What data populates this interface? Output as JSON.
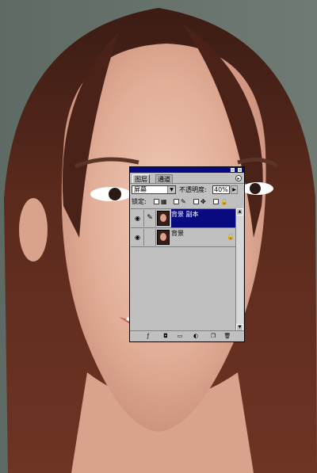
{
  "layers_panel": {
    "tabs": [
      {
        "label": "图层"
      },
      {
        "label": "通道"
      }
    ],
    "blend_mode": "屏幕",
    "opacity_label": "不透明度:",
    "opacity_value": "40%",
    "lock_label": "锁定:",
    "layers": [
      {
        "name": "背景 副本",
        "selected": true
      },
      {
        "name": "背景",
        "selected": false,
        "locked": true
      }
    ],
    "icons": {
      "eye": "eye-icon",
      "brush": "brush-icon",
      "lock": "lock-icon",
      "menu": "panel-menu-arrow-icon"
    }
  }
}
